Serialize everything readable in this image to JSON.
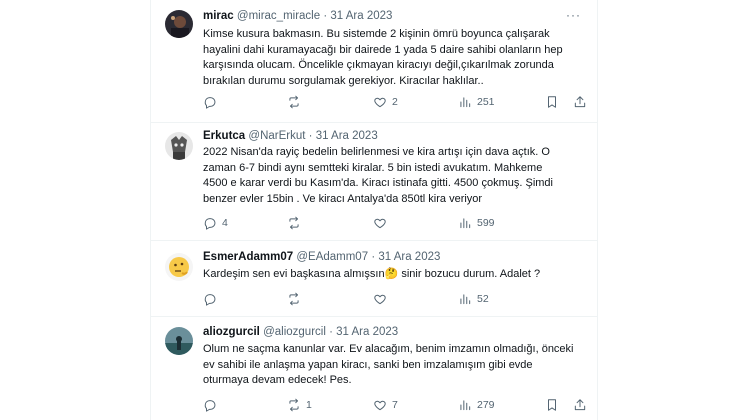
{
  "tweets": [
    {
      "name": "mirac",
      "handle": "@mirac_miracle",
      "sep": "·",
      "date": "31 Ara 2023",
      "lines": [
        "Kimse kusura bakmasın. Bu sistemde 2 kişinin ömrü boyunca çalışarak",
        "hayalini dahi kuramayacağı bir dairede 1 yada 5 daire sahibi olanların hep",
        "karşısında olucam. Öncelikle çıkmayan kiracıyı değil,çıkarılmak zorunda",
        "bırakılan durumu sorgulamak gerekiyor. Kiracılar haklılar.."
      ],
      "replies": "",
      "retweets": "",
      "likes": "2",
      "views": "251"
    },
    {
      "name": "Erkutca",
      "handle": "@NarErkut",
      "sep": "·",
      "date": "31 Ara 2023",
      "lines": [
        "2022 Nisan'da rayiç bedelin belirlenmesi ve kira artışı için dava açtık. O",
        "zaman 6-7 bindi aynı semtteki kiralar. 5 bin istedi avukatım. Mahkeme",
        "4500 e karar verdi bu Kasım'da. Kiracı istinafa gitti. 4500 çokmuş. Şimdi",
        "benzer evler 15bin . Ve kiracı Antalya'da 850tl kira veriyor"
      ],
      "replies": "4",
      "retweets": "",
      "likes": "",
      "views": "599"
    },
    {
      "name": "EsmerAdamm07",
      "handle": "@EAdamm07",
      "sep": "·",
      "date": "31 Ara 2023",
      "line_before_emoji": "Kardeşim sen evi başkasına almışsın",
      "line_after_emoji": " sinir bozucu durum. Adalet ?",
      "emoji": "🤔",
      "replies": "",
      "retweets": "",
      "likes": "",
      "views": "52"
    },
    {
      "name": "aliozgurcil",
      "handle": "@aliozgurcil",
      "sep": "·",
      "date": "31 Ara 2023",
      "lines": [
        "Olum ne saçma kanunlar var. Ev alacağım, benim imzamın olmadığı, önceki",
        "ev sahibi ile  anlaşma yapan kiracı, sanki ben imzalamışım gibi evde",
        "oturmaya devam edecek! Pes."
      ],
      "replies": "",
      "retweets": "1",
      "likes": "7",
      "views": "279"
    }
  ],
  "more_glyph": "···",
  "colors": {
    "text": "#0f1419",
    "muted": "#536471",
    "divider": "#eff3f4"
  }
}
